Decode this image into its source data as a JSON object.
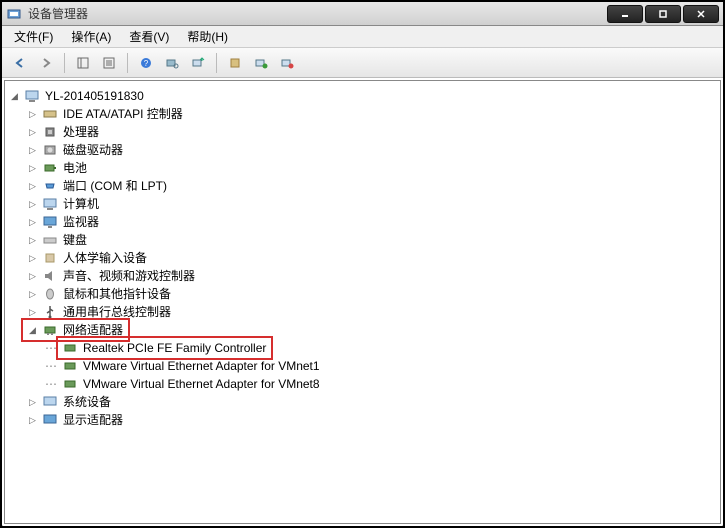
{
  "window": {
    "title": "设备管理器"
  },
  "menu": {
    "file": "文件(F)",
    "action": "操作(A)",
    "view": "查看(V)",
    "help": "帮助(H)"
  },
  "tree": {
    "root": "YL-201405191830",
    "items": {
      "ide": "IDE ATA/ATAPI 控制器",
      "cpu": "处理器",
      "disk": "磁盘驱动器",
      "battery": "电池",
      "ports": "端口 (COM 和 LPT)",
      "computer": "计算机",
      "monitor": "监视器",
      "keyboard": "键盘",
      "hid": "人体学输入设备",
      "sound": "声音、视频和游戏控制器",
      "mouse": "鼠标和其他指针设备",
      "usb": "通用串行总线控制器",
      "network": "网络适配器",
      "system": "系统设备",
      "display": "显示适配器"
    },
    "network_children": {
      "realtek": "Realtek PCIe FE Family Controller",
      "vmnet1": "VMware Virtual Ethernet Adapter for VMnet1",
      "vmnet8": "VMware Virtual Ethernet Adapter for VMnet8"
    }
  }
}
